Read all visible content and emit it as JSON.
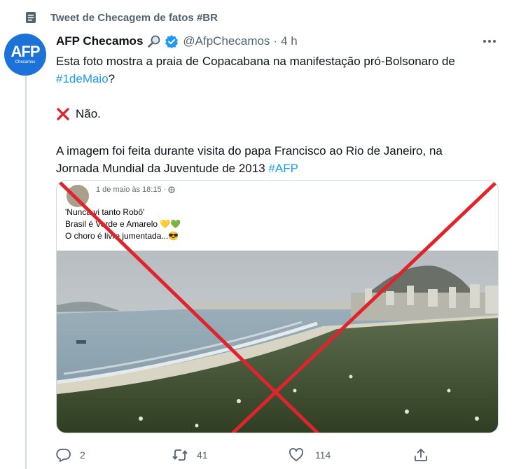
{
  "context": {
    "label": "Tweet de Checagem de fatos #BR"
  },
  "author": {
    "avatar_logo": "AFP",
    "avatar_sub": "Checamos",
    "name": "AFP Checamos",
    "handle": "@AfpChecamos",
    "separator": "·",
    "time": "4 h"
  },
  "tweet": {
    "line1": "Esta foto mostra a praia de Copacabana na manifestação pró-Bolsonaro de",
    "hashtag1": "#1deMaio",
    "line2_tail": "?",
    "verdict": "Não.",
    "line3": "A imagem foi feita durante visita do papa Francisco ao Rio de Janeiro, na",
    "line4": "Jornada Mundial da Juventude de 2013",
    "hashtag2": "#AFP"
  },
  "media": {
    "post_date": "1 de maio às 18:15 ·",
    "post_line1": "'Nunca vi tanto Robô'",
    "post_line2": "Brasil é Verde e Amarelo 💛💚",
    "post_line3": "O choro é livre jumentada...😎",
    "overlay_mark": "red-x",
    "colors": {
      "x_mark": "#e0242b",
      "sea": "#8fa7b4",
      "sky": "#c9ced1",
      "crowd": "#3c4d2a"
    }
  },
  "actions": {
    "replies": "2",
    "retweets": "41",
    "likes": "114"
  },
  "icons": [
    "document-icon",
    "search-icon",
    "verified-icon",
    "more-icon",
    "cross-icon",
    "reply-icon",
    "retweet-icon",
    "like-icon",
    "share-icon"
  ],
  "colors": {
    "accent": "#1d9bf0",
    "muted": "#536471",
    "avatar_bg": "#1d72d8"
  }
}
